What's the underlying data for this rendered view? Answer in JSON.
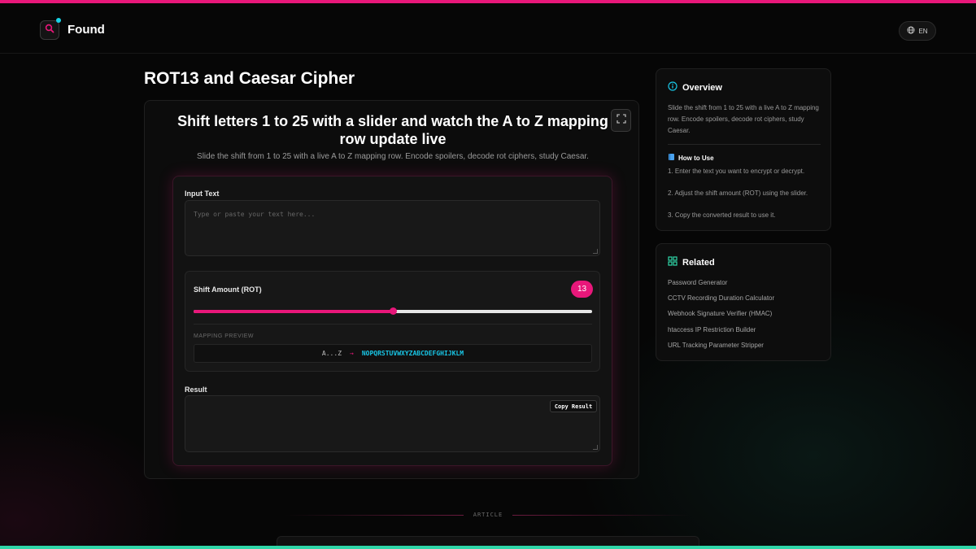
{
  "header": {
    "brand": "Found",
    "language": "EN"
  },
  "page": {
    "title": "ROT13 and Caesar Cipher"
  },
  "tool": {
    "heading": "Shift letters 1 to 25 with a slider and watch the A to Z mapping row update live",
    "subtitle": "Slide the shift from 1 to 25 with a live A to Z mapping row. Encode spoilers, decode rot ciphers, study Caesar.",
    "input_label": "Input Text",
    "input_placeholder": "Type or paste your text here...",
    "input_value": "",
    "shift_label": "Shift Amount (ROT)",
    "shift_value": "13",
    "slider": {
      "min": 1,
      "max": 25,
      "value": 13
    },
    "mapping_label": "MAPPING PREVIEW",
    "mapping_from": "A...Z",
    "mapping_arrow": "→",
    "mapping_to": "NOPQRSTUVWXYZABCDEFGHIJKLM",
    "result_label": "Result",
    "result_value": "",
    "copy_label": "Copy Result"
  },
  "sidebar": {
    "overview_title": "Overview",
    "overview_text": "Slide the shift from 1 to 25 with a live A to Z mapping row. Encode spoilers, decode rot ciphers, study Caesar.",
    "howto_title": "How to Use",
    "howto_steps": [
      "1. Enter the text you want to encrypt or decrypt.",
      "2. Adjust the shift amount (ROT) using the slider.",
      "3. Copy the converted result to use it."
    ],
    "related_title": "Related",
    "related_links": [
      "Password Generator",
      "CCTV Recording Duration Calculator",
      "Webhook Signature Verifier (HMAC)",
      "htaccess IP Restriction Builder",
      "URL Tracking Parameter Stripper"
    ]
  },
  "article": {
    "label": "ARTICLE"
  },
  "colors": {
    "accent_pink": "#e8177a",
    "accent_cyan": "#19c6e6",
    "accent_green": "#2fd6a8"
  }
}
